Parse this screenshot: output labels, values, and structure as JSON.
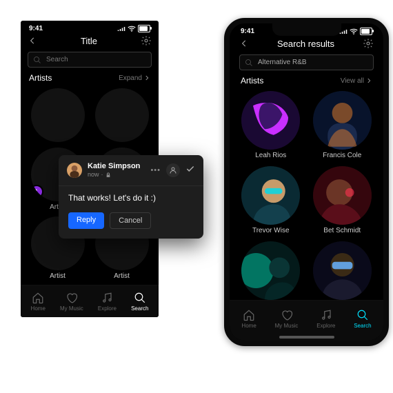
{
  "left": {
    "time": "9:41",
    "title": "Title",
    "search_placeholder": "Search",
    "section": "Artists",
    "expand": "Expand",
    "badge": "1",
    "cell_labels": [
      "Artist",
      "",
      "",
      "Artist",
      "Artist",
      "",
      ""
    ],
    "tabs": {
      "home": "Home",
      "music": "My Music",
      "explore": "Explore",
      "search": "Search"
    }
  },
  "right": {
    "time": "9:41",
    "title": "Search results",
    "search_value": "Alternative R&B",
    "section": "Artists",
    "viewall": "View all",
    "artists": [
      "Leah Rios",
      "Francis Cole",
      "Trevor Wise",
      "Bet Schmidt",
      "",
      ""
    ],
    "tabs": {
      "home": "Home",
      "music": "My Music",
      "explore": "Explore",
      "search": "Search"
    }
  },
  "card": {
    "name": "Katie Simpson",
    "time": "now",
    "body": "That works! Let's do it :)",
    "reply": "Reply",
    "cancel": "Cancel"
  }
}
